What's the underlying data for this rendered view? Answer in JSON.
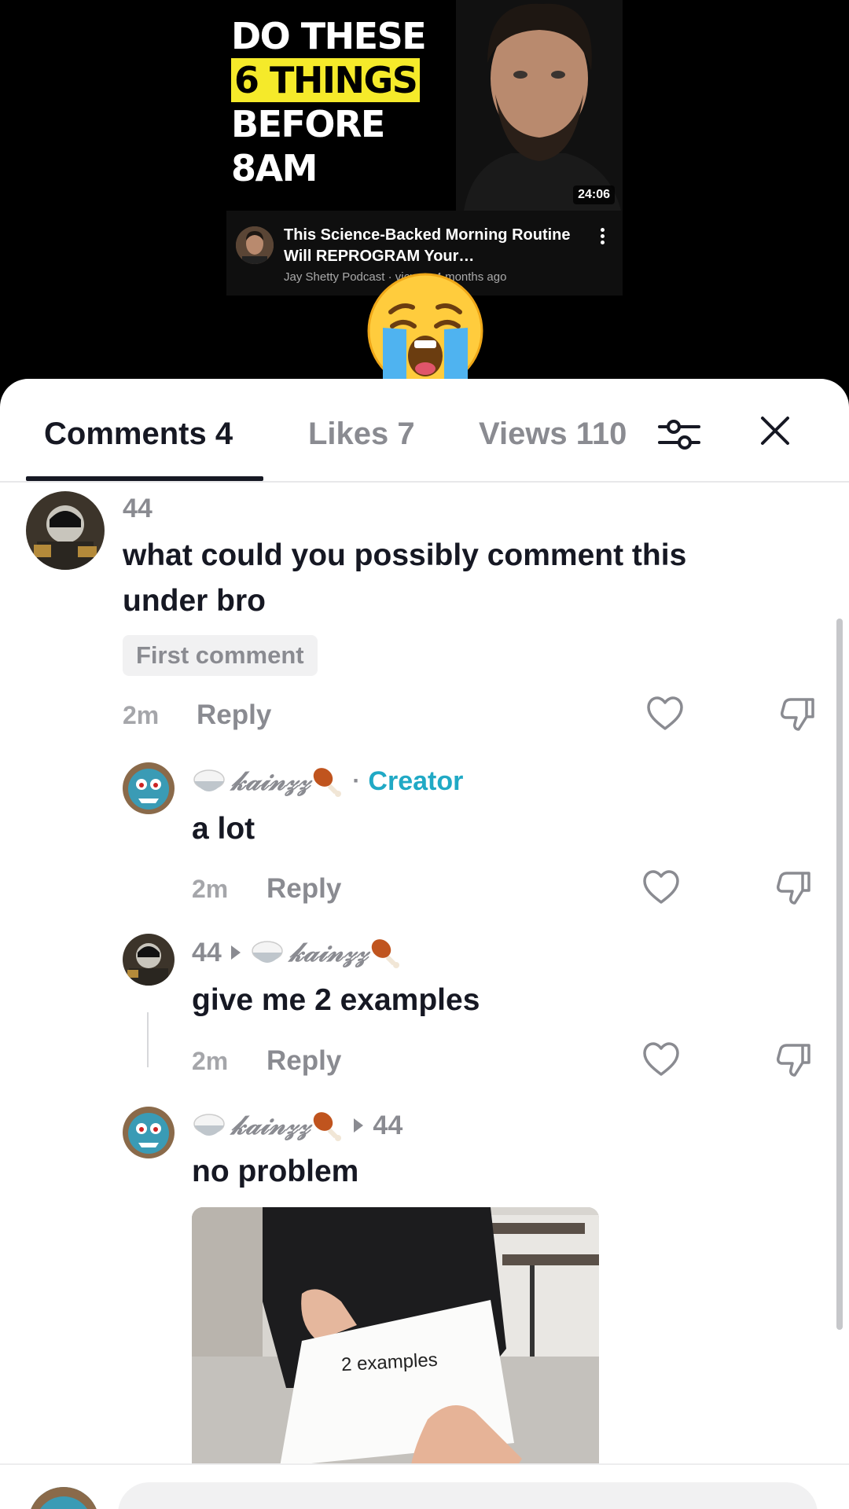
{
  "video": {
    "thumbnail_line1": "DO THESE",
    "thumbnail_line2": "6 THINGS",
    "thumbnail_line3": "BEFORE 8AM",
    "duration": "24:06",
    "title": "This Science-Backed Morning Routine Will REPROGRAM Your…",
    "subtitle": "Jay Shetty Podcast · views · 4 months ago",
    "reaction_emoji": "loudly-crying-face"
  },
  "tabs": {
    "comments": "Comments 4",
    "likes": "Likes 7",
    "views": "Views 110"
  },
  "comments": [
    {
      "username": "44",
      "text": "what could you possibly comment this under bro",
      "badge": "First comment",
      "time": "2m",
      "reply_label": "Reply"
    },
    {
      "username": "𝓀𝒶𝒾𝓃𝓏𝓏",
      "role": "Creator",
      "separator": "·",
      "text": "a lot",
      "time": "2m",
      "reply_label": "Reply"
    },
    {
      "username": "44",
      "reply_to": "𝓀𝒶𝒾𝓃𝓏𝓏",
      "text": "give me 2 examples",
      "time": "2m",
      "reply_label": "Reply"
    },
    {
      "username": "𝓀𝒶𝒾𝓃𝓏𝓏",
      "reply_to": "44",
      "text": "no problem",
      "gif_caption": "2 examples"
    }
  ],
  "colors": {
    "creator": "#20a9c5",
    "muted": "#8a8b91",
    "text": "#161823",
    "thumbnail_highlight": "#f5ea2a"
  }
}
